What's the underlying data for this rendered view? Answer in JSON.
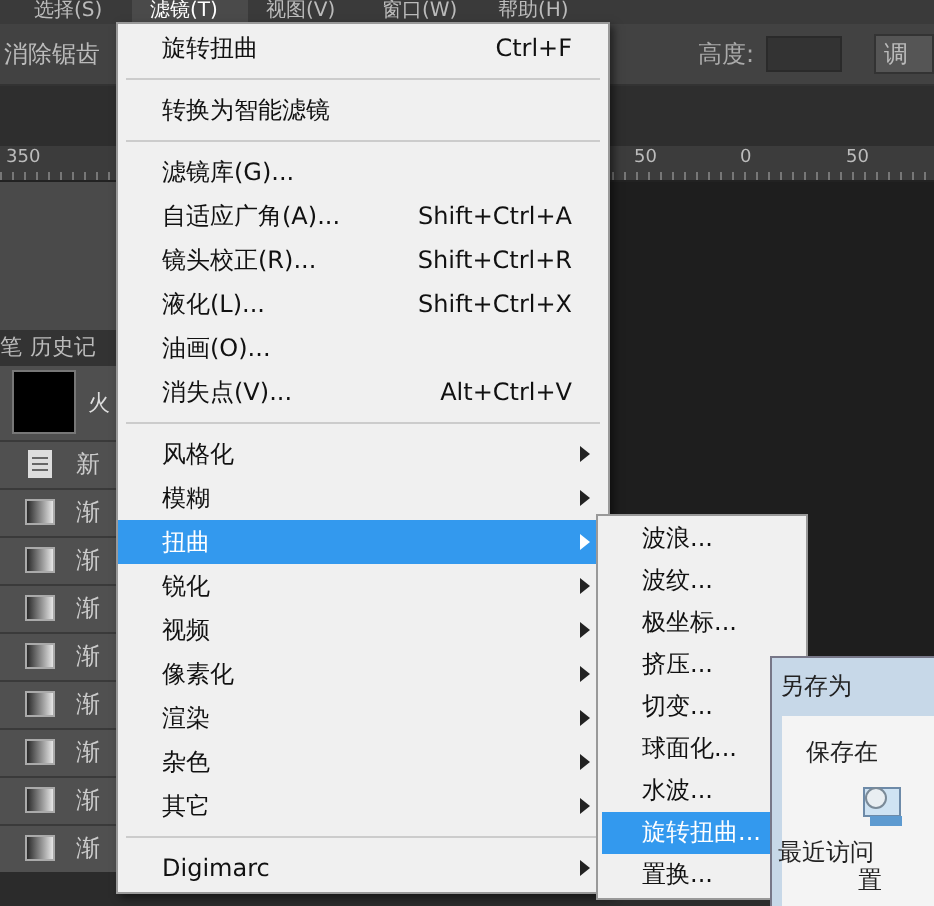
{
  "menu_bar": [
    {
      "label": "选择(S)",
      "selected": false
    },
    {
      "label": "滤镜(T)",
      "selected": true
    },
    {
      "label": "视图(V)",
      "selected": false
    },
    {
      "label": "窗口(W)",
      "selected": false
    },
    {
      "label": "帮助(H)",
      "selected": false
    }
  ],
  "options_bar": {
    "anti_alias": "消除锯齿",
    "height_label": "高度:",
    "button": "调"
  },
  "ruler": [
    "350",
    "50",
    "0",
    "50"
  ],
  "history_panel": {
    "tabs": [
      "笔",
      "历史记"
    ],
    "snapshot": "火",
    "rows": [
      {
        "kind": "document",
        "label": "新"
      },
      {
        "kind": "gradient",
        "label": "渐"
      },
      {
        "kind": "gradient",
        "label": "渐"
      },
      {
        "kind": "gradient",
        "label": "渐"
      },
      {
        "kind": "gradient",
        "label": "渐"
      },
      {
        "kind": "gradient",
        "label": "渐"
      },
      {
        "kind": "gradient",
        "label": "渐"
      },
      {
        "kind": "gradient",
        "label": "渐"
      },
      {
        "kind": "gradient",
        "label": "渐"
      }
    ]
  },
  "filter_menu": [
    {
      "kind": "item",
      "label": "旋转扭曲",
      "shortcut": "Ctrl+F",
      "selected": false
    },
    {
      "kind": "separator"
    },
    {
      "kind": "item",
      "label": "转换为智能滤镜",
      "selected": false
    },
    {
      "kind": "separator"
    },
    {
      "kind": "item",
      "label": "滤镜库(G)...",
      "selected": false
    },
    {
      "kind": "item",
      "label": "自适应广角(A)...",
      "shortcut": "Shift+Ctrl+A",
      "selected": false
    },
    {
      "kind": "item",
      "label": "镜头校正(R)...",
      "shortcut": "Shift+Ctrl+R",
      "selected": false
    },
    {
      "kind": "item",
      "label": "液化(L)...",
      "shortcut": "Shift+Ctrl+X",
      "selected": false
    },
    {
      "kind": "item",
      "label": "油画(O)...",
      "selected": false
    },
    {
      "kind": "item",
      "label": "消失点(V)...",
      "shortcut": "Alt+Ctrl+V",
      "selected": false
    },
    {
      "kind": "separator"
    },
    {
      "kind": "submenu",
      "label": "风格化",
      "selected": false
    },
    {
      "kind": "submenu",
      "label": "模糊",
      "selected": false
    },
    {
      "kind": "submenu",
      "label": "扭曲",
      "selected": true
    },
    {
      "kind": "submenu",
      "label": "锐化",
      "selected": false
    },
    {
      "kind": "submenu",
      "label": "视频",
      "selected": false
    },
    {
      "kind": "submenu",
      "label": "像素化",
      "selected": false
    },
    {
      "kind": "submenu",
      "label": "渲染",
      "selected": false
    },
    {
      "kind": "submenu",
      "label": "杂色",
      "selected": false
    },
    {
      "kind": "submenu",
      "label": "其它",
      "selected": false
    },
    {
      "kind": "separator"
    },
    {
      "kind": "submenu",
      "label": "Digimarc",
      "selected": false
    }
  ],
  "distort_submenu": [
    {
      "label": "波浪...",
      "selected": false
    },
    {
      "label": "波纹...",
      "selected": false
    },
    {
      "label": "极坐标...",
      "selected": false
    },
    {
      "label": "挤压...",
      "selected": false
    },
    {
      "label": "切变...",
      "selected": false
    },
    {
      "label": "球面化...",
      "selected": false
    },
    {
      "label": "水波...",
      "selected": false
    },
    {
      "label": "旋转扭曲...",
      "selected": true
    },
    {
      "label": "置换...",
      "selected": false
    }
  ],
  "save_dialog": {
    "title": "另存为",
    "save_in": "保存在",
    "place": "最近访问",
    "place_line2": "置"
  }
}
